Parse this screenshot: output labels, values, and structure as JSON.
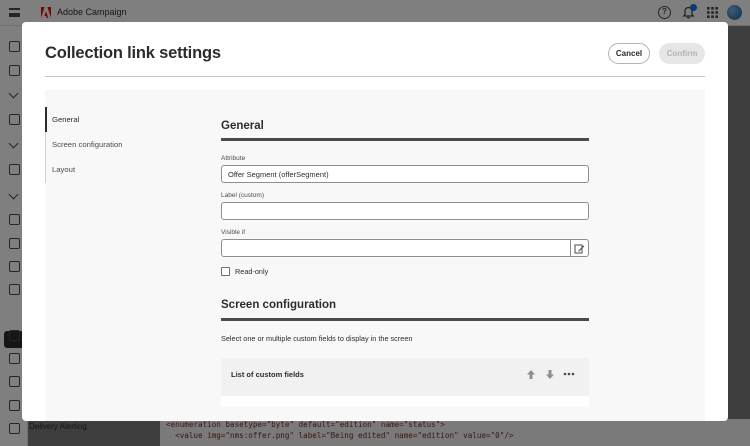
{
  "app": {
    "name": "Adobe Campaign",
    "accent": "#1473e6"
  },
  "topbar_icons": [
    "hamburger-icon",
    "help-icon",
    "bell-icon",
    "apps-grid-icon",
    "avatar"
  ],
  "background": {
    "footer_label": "Delivery Alerting",
    "code_lines": [
      "<enumeration basetype=\"byte\" default=\"edition\" name=\"status\">",
      "  <value img=\"nms:offer.png\" label=\"Being edited\" name=\"edition\" value=\"0\"/>"
    ]
  },
  "dialog": {
    "title": "Collection link settings",
    "cancel_label": "Cancel",
    "confirm_label": "Confirm",
    "nav": [
      {
        "label": "General",
        "active": true
      },
      {
        "label": "Screen configuration",
        "active": false
      },
      {
        "label": "Layout",
        "active": false
      }
    ],
    "general": {
      "heading": "General",
      "attribute_label": "Attribute",
      "attribute_value": "Offer Segment (offerSegment)",
      "label_custom_label": "Label (custom)",
      "label_custom_value": "",
      "visible_if_label": "Visible if",
      "visible_if_value": "",
      "readonly_label": "Read-only",
      "readonly_checked": false
    },
    "screen_config": {
      "heading": "Screen configuration",
      "description": "Select one or multiple custom fields to display in the screen",
      "list_title": "List of custom fields"
    }
  }
}
